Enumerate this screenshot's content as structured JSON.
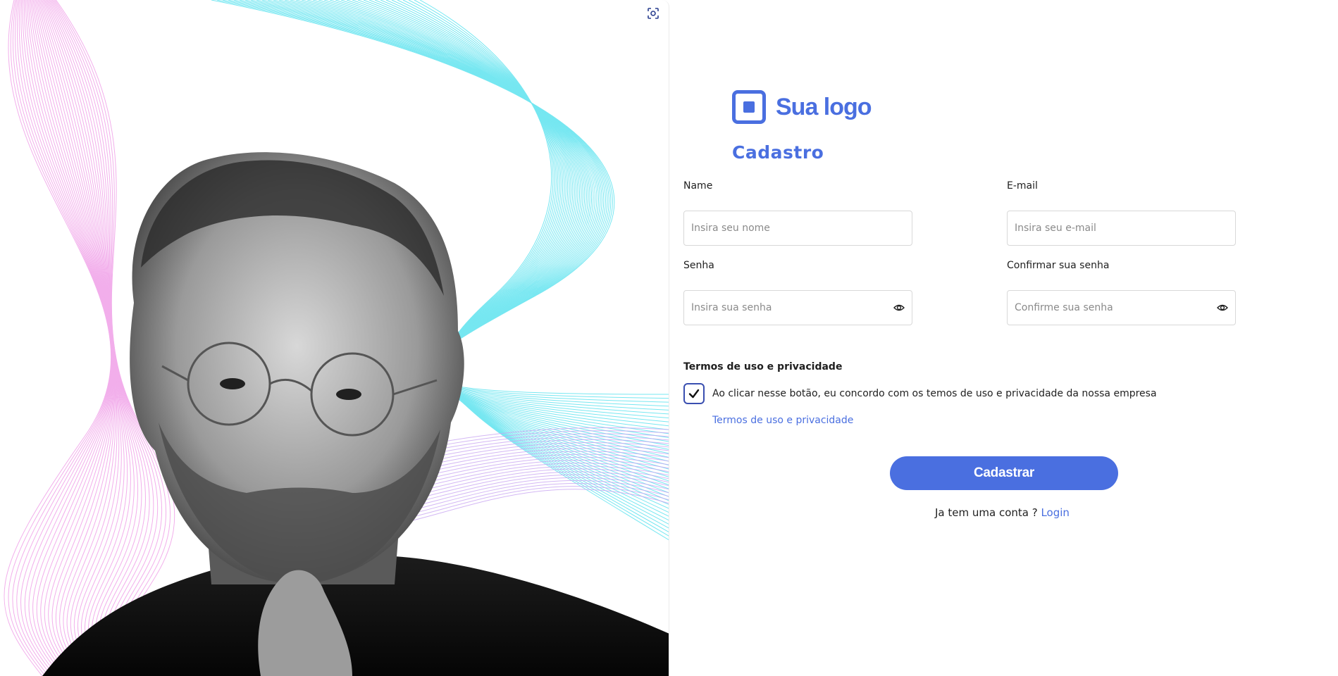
{
  "hero": {
    "image_label": "Portrait photo",
    "scan_icon": "focus-scan-icon"
  },
  "logo": {
    "icon": "logo-square-icon",
    "text": "Sua logo"
  },
  "form": {
    "title": "Cadastro",
    "name": {
      "label": "Name",
      "placeholder": "Insira seu nome"
    },
    "email": {
      "label": "E-mail",
      "placeholder": "Insira seu e-mail"
    },
    "password": {
      "label": "Senha",
      "placeholder": "Insira sua senha",
      "icon": "eye-icon"
    },
    "confirm_password": {
      "label": "Confirmar sua senha",
      "placeholder": "Confirme sua senha",
      "icon": "eye-icon"
    },
    "terms_heading": "Termos de uso e privacidade",
    "terms_checkbox": {
      "checked": true,
      "text": "Ao clicar nesse botão, eu concordo com os temos de uso e privacidade da nossa empresa"
    },
    "terms_link": "Termos de uso e privacidade",
    "submit_label": "Cadastrar",
    "login_prompt": "Ja tem uma conta ?",
    "login_link": "Login"
  },
  "colors": {
    "accent": "#4a6fe0",
    "wave_cyan": "#5fe3ef",
    "wave_pink": "#f0a0e8"
  }
}
